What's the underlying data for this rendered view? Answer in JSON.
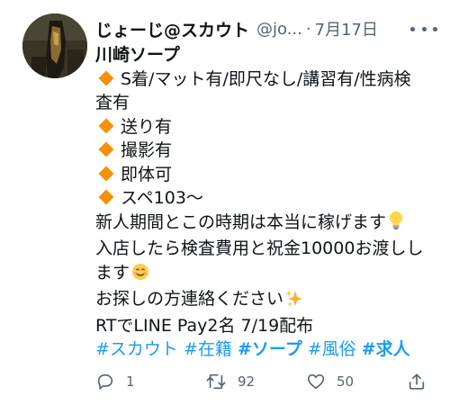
{
  "tweet": {
    "display_name": "じょーじ@スカウト",
    "handle": "@jo...",
    "separator": "·",
    "date": "7月17日",
    "lines": {
      "l1": "川崎ソープ",
      "l2": "S着/マット有/即尺なし/講習有/性病検",
      "l3": "査有",
      "l4": "送り有",
      "l5": "撮影有",
      "l6": "即体可",
      "l7": "スペ103〜",
      "l8": "新人期間とこの時期は本当に稼げます",
      "l9": "入店したら検査費用と祝金10000お渡しし",
      "l10": "ます",
      "l11": "お探しの方連絡ください",
      "l12": "RTでLINE Pay2名 7/19配布"
    },
    "hashtags": [
      "#スカウト",
      "#在籍",
      "#ソープ",
      "#風俗",
      "#求人"
    ],
    "actions": {
      "replies": "1",
      "retweets": "92",
      "likes": "50"
    }
  },
  "icons": {
    "reply": "reply-icon",
    "retweet": "retweet-icon",
    "like": "heart-icon",
    "share": "share-icon",
    "more": "more-icon",
    "bullet": "orange-diamond-icon",
    "lightbulb": "lightbulb-emoji",
    "smile": "smiling-face-emoji",
    "sparkles": "sparkles-emoji"
  },
  "colors": {
    "text": "#0f1419",
    "secondary": "#536471",
    "link": "#1d9bf0",
    "bullet": "#f4900c"
  }
}
